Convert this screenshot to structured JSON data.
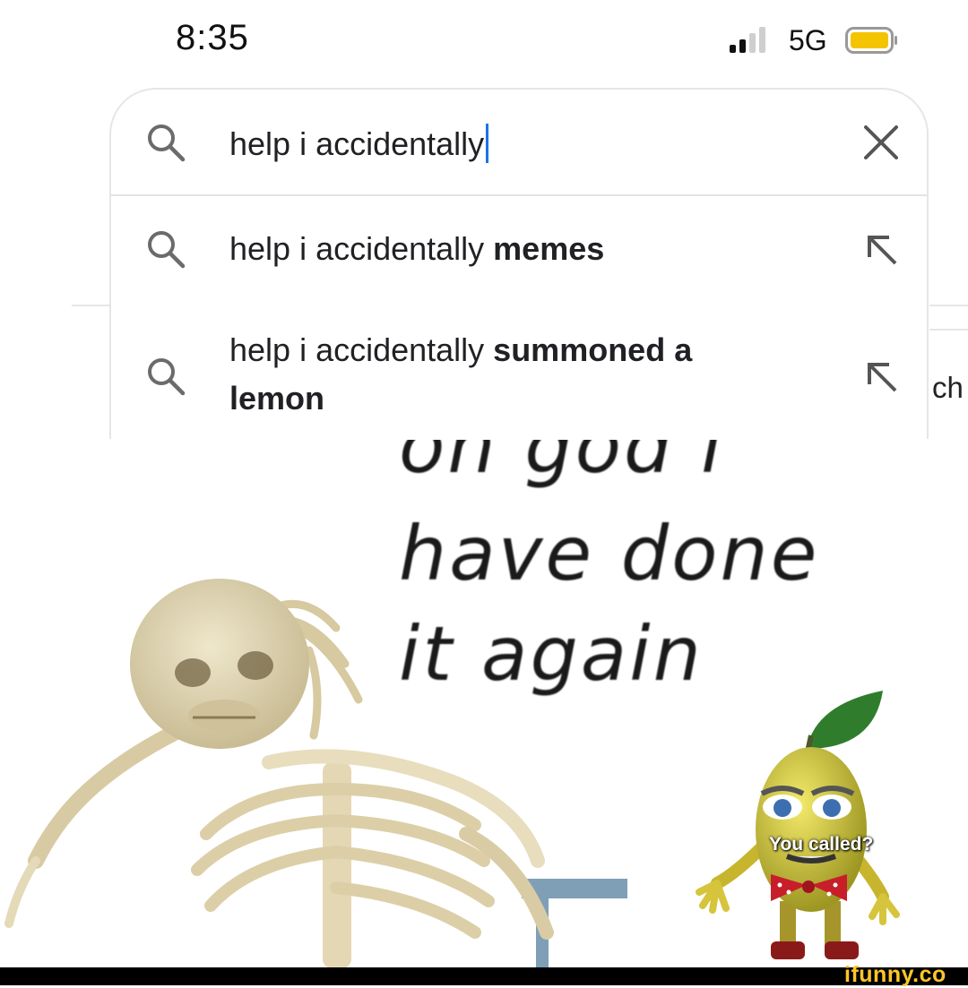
{
  "status_bar": {
    "time": "8:35",
    "network": "5G",
    "battery_color": "#f5c400"
  },
  "search": {
    "query": "help i accidentally",
    "suggestions": [
      {
        "prefix": "help i accidentally ",
        "bold": "memes",
        "bold2": ""
      },
      {
        "prefix": "help i accidentally ",
        "bold": "summoned a",
        "bold2": "lemon"
      }
    ],
    "accent_color": "#1a73e8"
  },
  "background_page": {
    "peek_text": "ch"
  },
  "meme": {
    "caption_lines": [
      "on god i",
      "have done",
      "it again"
    ],
    "lemon_speech": "You called?"
  },
  "footer": {
    "brand": "ifunny.co"
  }
}
